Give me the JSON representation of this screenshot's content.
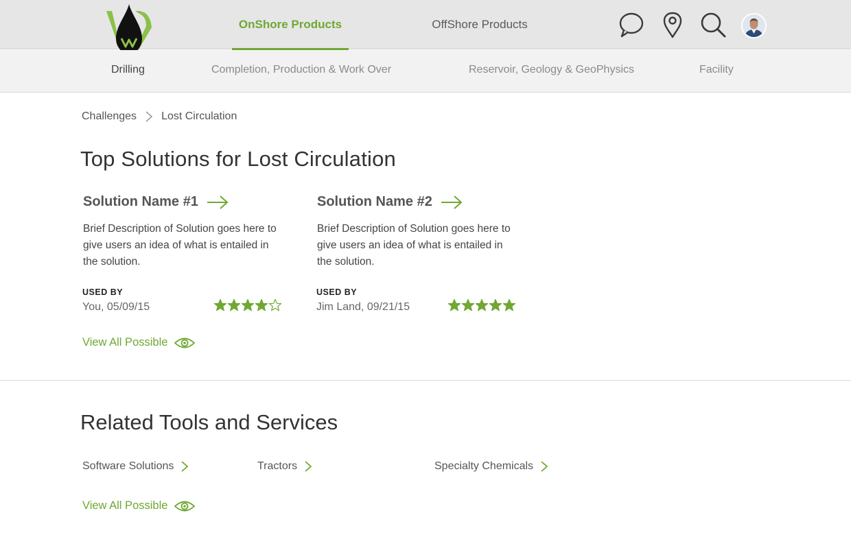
{
  "header": {
    "tabs": [
      {
        "label": "OnShore Products",
        "active": true
      },
      {
        "label": "OffShore Products",
        "active": false
      }
    ],
    "icons": [
      "chat-icon",
      "map-pin-icon",
      "search-icon",
      "avatar"
    ]
  },
  "subnav": {
    "items": [
      {
        "label": "Drilling",
        "active": true
      },
      {
        "label": "Completion, Production & Work Over",
        "active": false
      },
      {
        "label": "Reservoir, Geology & GeoPhysics",
        "active": false
      },
      {
        "label": "Facility",
        "active": false
      }
    ]
  },
  "breadcrumb": {
    "items": [
      "Challenges",
      "Lost Circulation"
    ]
  },
  "page_title": "Top Solutions for Lost Circulation",
  "solutions": [
    {
      "title": "Solution Name #1",
      "description": "Brief Description of Solution goes here to give users an idea of what is entailed in the solution.",
      "used_by_label": "USED BY",
      "used_by": "You, 05/09/15",
      "rating": 4,
      "rating_max": 5
    },
    {
      "title": "Solution Name #2",
      "description": "Brief Description of Solution goes here to give users an idea of what is entailed in the solution.",
      "used_by_label": "USED BY",
      "used_by": "Jim Land, 09/21/15",
      "rating": 5,
      "rating_max": 5
    }
  ],
  "view_all_label": "View All Possible",
  "related": {
    "title": "Related Tools and Services",
    "items": [
      "Software Solutions",
      "Tractors",
      "Specialty Chemicals"
    ],
    "view_all_label": "View All Possible"
  },
  "colors": {
    "accent": "#6fa832",
    "topbar": "#e6e6e6",
    "subnav": "#f2f2f2"
  }
}
